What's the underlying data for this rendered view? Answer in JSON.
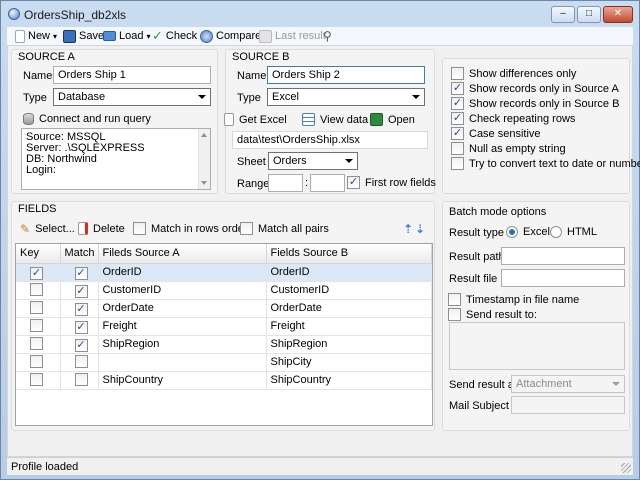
{
  "window": {
    "title": "OrdersShip_db2xls"
  },
  "title_buttons": {
    "minimize": "‒",
    "maximize": "□",
    "close": "✕"
  },
  "toolbar": {
    "new_label": "New",
    "save_label": "Save",
    "load_label": "Load",
    "check_label": "Check",
    "compare_label": "Compare",
    "last_result_label": "Last result"
  },
  "source_a": {
    "header": "SOURCE A",
    "name_label": "Name",
    "name_value": "Orders Ship 1",
    "type_label": "Type",
    "type_value": "Database",
    "connect_label": "Connect and run query",
    "connection_lines": [
      "Source: MSSQL",
      "Server: .\\SQLEXPRESS",
      "DB: Northwind",
      "Login:"
    ]
  },
  "source_b": {
    "header": "SOURCE B",
    "name_label": "Name",
    "name_value": "Orders Ship 2",
    "type_label": "Type",
    "type_value": "Excel",
    "get_excel_label": "Get Excel",
    "view_data_label": "View data",
    "open_label": "Open",
    "path_value": "data\\test\\OrdersShip.xlsx",
    "sheet_label": "Sheet",
    "sheet_value": "Orders",
    "range_label": "Range",
    "range_sep": ":",
    "first_row_label": "First row fields",
    "first_row_checked": true
  },
  "options": [
    {
      "label": "Show differences only",
      "checked": false
    },
    {
      "label": "Show records only in Source A",
      "checked": true
    },
    {
      "label": "Show records only in Source B",
      "checked": true
    },
    {
      "label": "Check repeating rows",
      "checked": true
    },
    {
      "label": "Case sensitive",
      "checked": true
    },
    {
      "label": "Null as empty string",
      "checked": false
    },
    {
      "label": "Try to convert text to date or number",
      "checked": false
    }
  ],
  "fields": {
    "header": "FIELDS",
    "select_label": "Select...",
    "delete_label": "Delete",
    "match_rows_order_label": "Match in rows order",
    "match_all_pairs_label": "Match all pairs",
    "columns": [
      "Key",
      "Match",
      "Fileds Source A",
      "Fields Source B"
    ],
    "rows": [
      {
        "key": true,
        "match": true,
        "a": "OrderID",
        "b": "OrderID"
      },
      {
        "key": false,
        "match": true,
        "a": "CustomerID",
        "b": "CustomerID"
      },
      {
        "key": false,
        "match": true,
        "a": "OrderDate",
        "b": "OrderDate"
      },
      {
        "key": false,
        "match": true,
        "a": "Freight",
        "b": "Freight"
      },
      {
        "key": false,
        "match": true,
        "a": "ShipRegion",
        "b": "ShipRegion"
      },
      {
        "key": false,
        "match": false,
        "a": "",
        "b": "ShipCity"
      },
      {
        "key": false,
        "match": false,
        "a": "ShipCountry",
        "b": "ShipCountry"
      }
    ]
  },
  "batch": {
    "header": "Batch mode options",
    "result_type_label": "Result type",
    "excel_label": "Excel",
    "html_label": "HTML",
    "result_type_selected": "Excel",
    "result_path_label": "Result path",
    "result_file_label": "Result file",
    "timestamp_label": "Timestamp in file name",
    "send_result_label": "Send result to:",
    "send_as_label": "Send result as",
    "send_as_value": "Attachment",
    "mail_subject_label": "Mail Subject"
  },
  "status": {
    "text": "Profile loaded"
  },
  "colors": {
    "title_bg": "#c9dcf0",
    "selected_row": "#dbe8f8",
    "accent": "#2f7fd8"
  }
}
